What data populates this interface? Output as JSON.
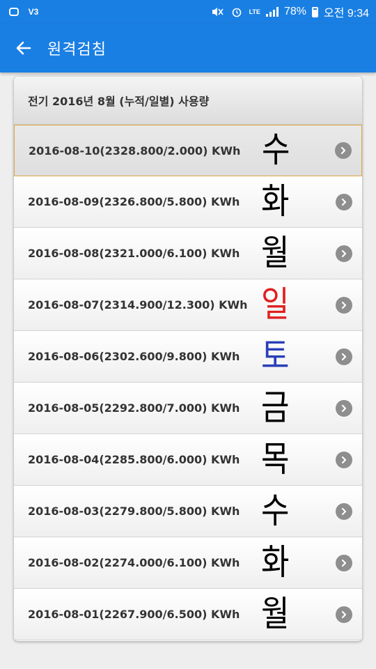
{
  "status_bar": {
    "battery": "78%",
    "time": "오전 9:34",
    "network": "LTE"
  },
  "app_bar": {
    "title": "원격검침"
  },
  "list": {
    "header": "전기 2016년 8월 (누적/일별) 사용량",
    "items": [
      {
        "label": "2016-08-10(2328.800/2.000) KWh",
        "note": "수",
        "note_color": "#000000",
        "selected": true
      },
      {
        "label": "2016-08-09(2326.800/5.800) KWh",
        "note": "화",
        "note_color": "#000000"
      },
      {
        "label": "2016-08-08(2321.000/6.100) KWh",
        "note": "월",
        "note_color": "#000000"
      },
      {
        "label": "2016-08-07(2314.900/12.300) KWh",
        "note": "일",
        "note_color": "#e02020"
      },
      {
        "label": "2016-08-06(2302.600/9.800) KWh",
        "note": "토",
        "note_color": "#2a3fb8"
      },
      {
        "label": "2016-08-05(2292.800/7.000) KWh",
        "note": "금",
        "note_color": "#000000"
      },
      {
        "label": "2016-08-04(2285.800/6.000) KWh",
        "note": "목",
        "note_color": "#000000"
      },
      {
        "label": "2016-08-03(2279.800/5.800) KWh",
        "note": "수",
        "note_color": "#000000"
      },
      {
        "label": "2016-08-02(2274.000/6.100) KWh",
        "note": "화",
        "note_color": "#000000"
      },
      {
        "label": "2016-08-01(2267.900/6.500) KWh",
        "note": "월",
        "note_color": "#000000"
      }
    ]
  },
  "colors": {
    "primary": "#1a7fe3",
    "selected_border": "#e0a840",
    "chevron": "#8e8e8e"
  }
}
